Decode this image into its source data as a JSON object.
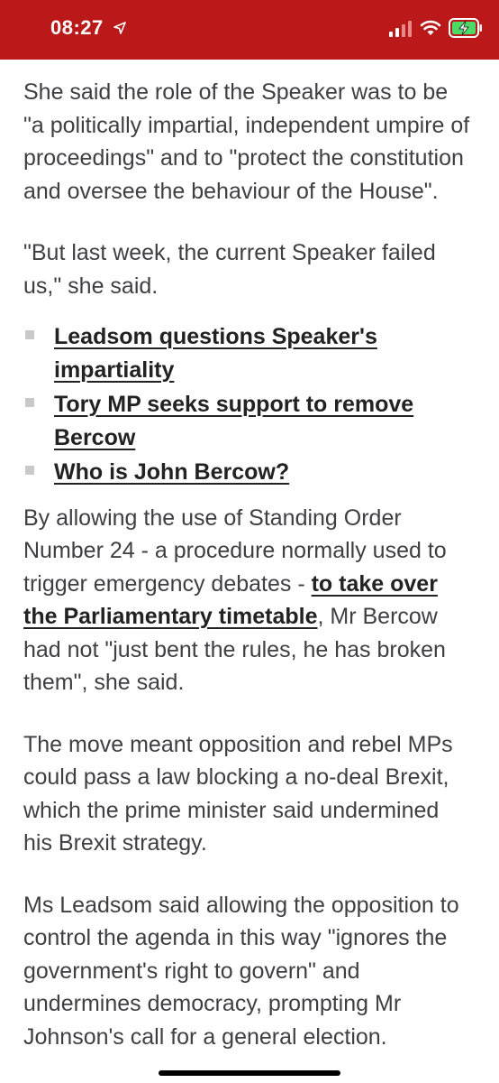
{
  "status_bar": {
    "time": "08:27",
    "background_color": "#bb1919",
    "icons": [
      "location-arrow-icon",
      "cellular-signal-icon",
      "wifi-icon",
      "battery-charging-icon"
    ]
  },
  "article": {
    "para1": "She said the role of the Speaker was to be \"a politically impartial, independent umpire of proceedings\" and to \"protect the constitution and oversee the behaviour of the House\".",
    "para2": "\"But last week, the current Speaker failed us,\" she said.",
    "related_links": [
      "Leadsom questions Speaker's impartiality",
      "Tory MP seeks support to remove Bercow",
      "Who is John Bercow?"
    ],
    "para3_before": "By allowing the use of Standing Order Number 24 - a procedure normally used to trigger emergency debates - ",
    "para3_link": "to take over the Parliamentary timetable",
    "para3_after": ", Mr Bercow had not \"just bent the rules, he has broken them\", she said.",
    "para4": "The move meant opposition and rebel MPs could pass a law blocking a no-deal Brexit, which the prime minister said undermined his Brexit strategy.",
    "para5": "Ms Leadsom said allowing the opposition to control the agenda in this way \"ignores the government's right to govern\" and undermines democracy, prompting Mr Johnson's call for a general election."
  }
}
